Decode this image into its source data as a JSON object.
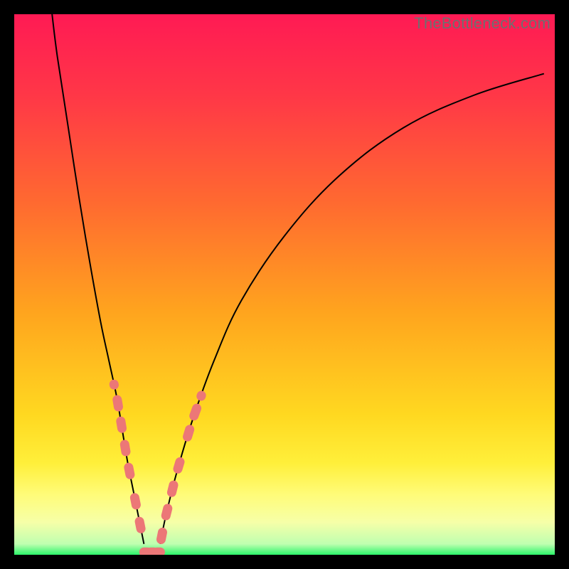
{
  "watermark": "TheBottleneck.com",
  "colors": {
    "background": "#000000",
    "gradient_stops": {
      "c0": "#ff1a54",
      "c1": "#ff3747",
      "c2": "#ff6a30",
      "c3": "#ffa41e",
      "c4": "#ffd820",
      "c5": "#ffef3a",
      "c6": "#fffc7a",
      "c7": "#f6ffa8",
      "c8": "#bfffb0",
      "c9": "#2cf56a"
    },
    "curve_stroke": "#000000",
    "marker_fill": "#ec7777",
    "marker_stroke": "#ec7777"
  },
  "chart_data": {
    "type": "line",
    "title": "",
    "xlabel": "",
    "ylabel": "",
    "xlim": [
      0,
      100
    ],
    "ylim": [
      0,
      100
    ],
    "grid": false,
    "series": [
      {
        "name": "left-branch",
        "x": [
          7,
          8,
          10,
          12,
          14,
          16,
          17.5,
          19,
          20,
          21,
          22,
          23,
          24
        ],
        "y": [
          100,
          92,
          79,
          66,
          54,
          43,
          36,
          29,
          23,
          17,
          12,
          7,
          2
        ]
      },
      {
        "name": "right-branch",
        "x": [
          27,
          28,
          30,
          33,
          37,
          42,
          50,
          60,
          72,
          85,
          98
        ],
        "y": [
          2,
          7,
          15,
          25,
          36,
          47,
          59,
          70,
          79,
          85,
          89
        ]
      }
    ],
    "bottom_flat": {
      "x_start": 24,
      "x_end": 27,
      "y": 0.5
    },
    "markers": {
      "shape": "rounded-capsule",
      "clusters": [
        {
          "branch": "left",
          "y_start": 14,
          "y_end": 32
        },
        {
          "branch": "left",
          "y_start": 4,
          "y_end": 12
        },
        {
          "branch": "right",
          "y_start": 2,
          "y_end": 18
        },
        {
          "branch": "right",
          "y_start": 21,
          "y_end": 30
        }
      ]
    },
    "note": "V-shaped bottleneck curve on rainbow gradient; y is percentage-like, x is component index. Axes unlabeled in source."
  }
}
